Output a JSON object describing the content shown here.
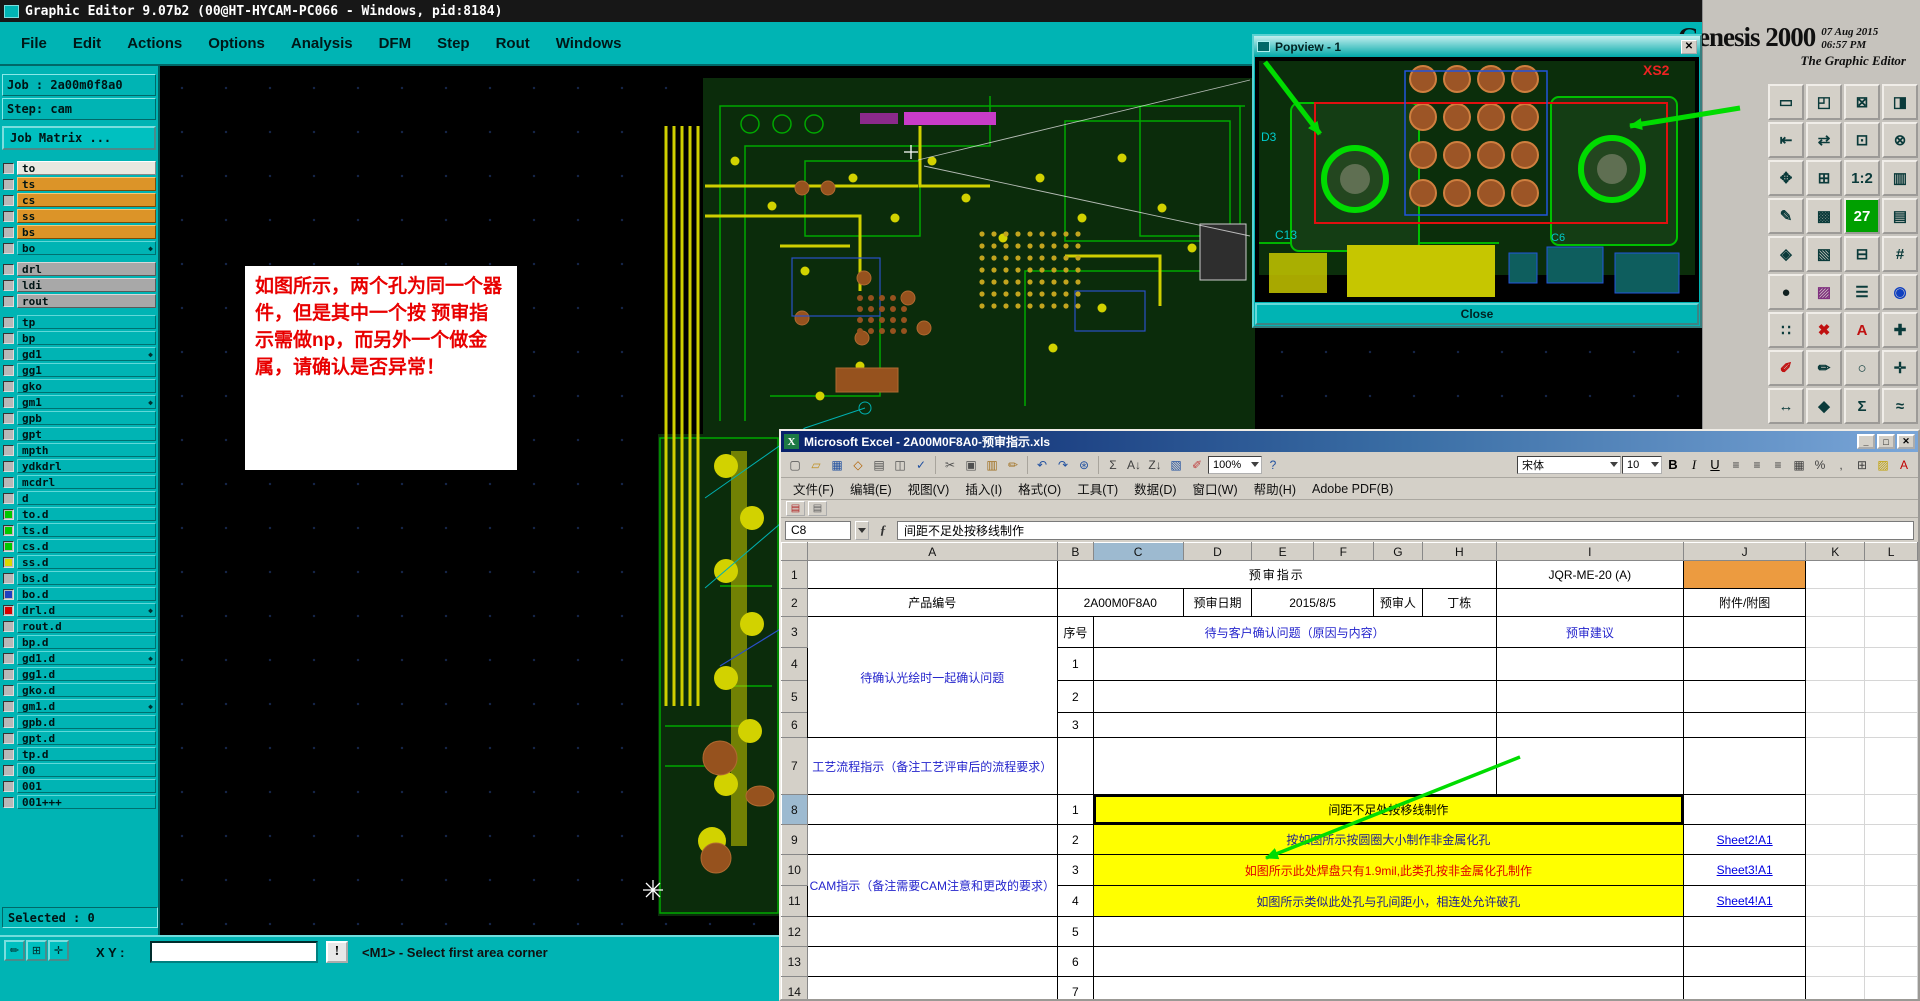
{
  "genesis": {
    "title": "Graphic Editor 9.07b2 (00@HT-HYCAM-PC066 - Windows, pid:8184)",
    "menu": [
      "File",
      "Edit",
      "Actions",
      "Options",
      "Analysis",
      "DFM",
      "Step",
      "Rout",
      "Windows"
    ],
    "job": "Job : 2a00m0f8a0",
    "step": "Step: cam",
    "matrix": "Job Matrix ...",
    "logo": {
      "brand": "Genesis 2000",
      "date": "07 Aug 2015",
      "time": "06:57 PM",
      "subtitle": "The Graphic Editor"
    },
    "layers": [
      {
        "label": "to",
        "color": "white"
      },
      {
        "label": "ts",
        "color": "orange"
      },
      {
        "label": "cs",
        "color": "orange"
      },
      {
        "label": "ss",
        "color": "orange"
      },
      {
        "label": "bs",
        "color": "orange"
      },
      {
        "label": "bo",
        "color": "teal",
        "marker": true
      },
      {
        "gap": true
      },
      {
        "label": "drl",
        "color": "gray"
      },
      {
        "label": "ldi",
        "color": "gray"
      },
      {
        "label": "rout",
        "color": "gray"
      },
      {
        "gap": true
      },
      {
        "label": "tp",
        "color": "teal"
      },
      {
        "label": "bp",
        "color": "teal"
      },
      {
        "label": "gd1",
        "color": "teal",
        "marker": true
      },
      {
        "label": "gg1",
        "color": "teal"
      },
      {
        "label": "gko",
        "color": "teal"
      },
      {
        "label": "gm1",
        "color": "teal",
        "marker": true
      },
      {
        "label": "gpb",
        "color": "teal"
      },
      {
        "label": "gpt",
        "color": "teal"
      },
      {
        "label": "mpth",
        "color": "teal"
      },
      {
        "label": "ydkdrl",
        "color": "teal"
      },
      {
        "label": "mcdrl",
        "color": "teal"
      },
      {
        "label": "d",
        "color": "teal"
      },
      {
        "label": "to.d",
        "color": "teal",
        "dot": "#00c800"
      },
      {
        "label": "ts.d",
        "color": "teal",
        "dot": "#00c800"
      },
      {
        "label": "cs.d",
        "color": "teal",
        "dot": "#00c800"
      },
      {
        "label": "ss.d",
        "color": "teal",
        "dot": "#d8d800"
      },
      {
        "label": "bs.d",
        "color": "teal"
      },
      {
        "label": "bo.d",
        "color": "teal",
        "dot": "#2040c0"
      },
      {
        "label": "drl.d",
        "color": "teal",
        "dot": "#d80000",
        "marker": true
      },
      {
        "label": "rout.d",
        "color": "teal"
      },
      {
        "label": "bp.d",
        "color": "teal"
      },
      {
        "label": "gd1.d",
        "color": "teal",
        "marker": true
      },
      {
        "label": "gg1.d",
        "color": "teal"
      },
      {
        "label": "gko.d",
        "color": "teal"
      },
      {
        "label": "gm1.d",
        "color": "teal",
        "marker": true
      },
      {
        "label": "gpb.d",
        "color": "teal"
      },
      {
        "label": "gpt.d",
        "color": "teal"
      },
      {
        "label": "tp.d",
        "color": "teal"
      },
      {
        "label": "00",
        "color": "teal"
      },
      {
        "label": "001",
        "color": "teal"
      },
      {
        "label": "001+++",
        "color": "teal"
      }
    ],
    "annotation": "如图所示，两个孔为同一个器件，但是其中一个按 预审指示需做np，而另外一个做金属，请确认是否异常！",
    "selected": "Selected : 0",
    "xy_label": "X Y :",
    "xy_value": "",
    "alert": "!",
    "status_message": "<M1> - Select first area corner",
    "status_buttons": [
      {
        "name": "select-mode-icon",
        "glyph": "✏"
      },
      {
        "name": "grid-toggle-icon",
        "glyph": "⊞"
      },
      {
        "name": "snap-toggle-icon",
        "glyph": "✛"
      }
    ],
    "toolbar_icons": [
      {
        "name": "screen-icon",
        "glyph": "▭",
        "color": "#0a3a3a"
      },
      {
        "name": "swap-screen-icon",
        "glyph": "◰",
        "color": "#0a3a3a"
      },
      {
        "name": "lock-icon",
        "glyph": "⊠",
        "color": "#0a3a3a"
      },
      {
        "name": "panel-icon",
        "glyph": "◨",
        "color": "#0a3a3a"
      },
      {
        "name": "pan-left-icon",
        "glyph": "⇤",
        "color": "#0a3a3a"
      },
      {
        "name": "pan-swap-icon",
        "glyph": "⇄",
        "color": "#0a3a3a"
      },
      {
        "name": "center-view-icon",
        "glyph": "⊡",
        "color": "#0a3a3a"
      },
      {
        "name": "close-view-icon",
        "glyph": "⊗",
        "color": "#0a3a3a"
      },
      {
        "name": "fit-view-icon",
        "glyph": "✥",
        "color": "#0a3a3a"
      },
      {
        "name": "grid-icon",
        "glyph": "⊞",
        "color": "#0a3a3a"
      },
      {
        "name": "zoom-1-2-icon",
        "glyph": "1:2",
        "color": "#0a3a3a"
      },
      {
        "name": "layers-view-icon",
        "glyph": "▥",
        "color": "#0a3a3a"
      },
      {
        "name": "edit-profile-icon",
        "glyph": "✎",
        "color": "#0a3a3a"
      },
      {
        "name": "hatch-icon",
        "glyph": "▩",
        "color": "#0a3a3a"
      },
      {
        "name": "badge-27-icon",
        "glyph": "27",
        "color": "#ffffff",
        "bg": "#00a000"
      },
      {
        "name": "rows-icon",
        "glyph": "▤",
        "color": "#0a3a3a"
      },
      {
        "name": "diamond-view-icon",
        "glyph": "◈",
        "color": "#0a3a3a"
      },
      {
        "name": "shade-icon",
        "glyph": "▧",
        "color": "#0a3a3a"
      },
      {
        "name": "minus-box-icon",
        "glyph": "⊟",
        "color": "#0a3a3a"
      },
      {
        "name": "net-icon",
        "glyph": "#",
        "color": "#0a3a3a"
      },
      {
        "name": "dot-icon",
        "glyph": "●",
        "color": "#102020"
      },
      {
        "name": "pattern-icon",
        "glyph": "▨",
        "color": "#803080"
      },
      {
        "name": "list-icon",
        "glyph": "☰",
        "color": "#0a3a3a"
      },
      {
        "name": "target-icon",
        "glyph": "◉",
        "color": "#1040c0"
      },
      {
        "name": "matrix-dots-icon",
        "glyph": "∷",
        "color": "#0a3a3a"
      },
      {
        "name": "delete-icon",
        "glyph": "✖",
        "color": "#c01010"
      },
      {
        "name": "text-a-icon",
        "glyph": "A",
        "color": "#c01010"
      },
      {
        "name": "add-icon",
        "glyph": "✚",
        "color": "#0a3a3a"
      },
      {
        "name": "pen-red-icon",
        "glyph": "✐",
        "color": "#c01010"
      },
      {
        "name": "pencil-icon",
        "glyph": "✏",
        "color": "#0a3a3a"
      },
      {
        "name": "circle-icon",
        "glyph": "○",
        "color": "#0a3a3a"
      },
      {
        "name": "cross-icon",
        "glyph": "✛",
        "color": "#0a3a3a"
      },
      {
        "name": "move-icon",
        "glyph": "↔",
        "color": "#0a3a3a"
      },
      {
        "name": "diamond-icon",
        "glyph": "◆",
        "color": "#0a3a3a"
      },
      {
        "name": "sum-icon",
        "glyph": "Σ",
        "color": "#0a3a3a"
      },
      {
        "name": "wave-icon",
        "glyph": "≈",
        "color": "#0a3a3a"
      }
    ]
  },
  "popview": {
    "title": "Popview - 1",
    "close_label": "Close",
    "close_icon": "✕",
    "labels": {
      "xs2": "XS2",
      "d3": "D3",
      "c13": "C13",
      "c6": "C6"
    }
  },
  "excel": {
    "title": "Microsoft Excel - 2A00M0F8A0-预审指示.xls",
    "app_icon": "X",
    "window_controls": [
      {
        "name": "minimize-button",
        "glyph": "_"
      },
      {
        "name": "maximize-button",
        "glyph": "□"
      },
      {
        "name": "close-button",
        "glyph": "✕"
      }
    ],
    "menus": [
      "文件(F)",
      "编辑(E)",
      "视图(V)",
      "插入(I)",
      "格式(O)",
      "工具(T)",
      "数据(D)",
      "窗口(W)",
      "帮助(H)",
      "Adobe PDF(B)"
    ],
    "zoom": "100%",
    "help_icon": {
      "glyph": "?",
      "color": "#2050a0"
    },
    "font_name": "宋体",
    "font_size": "10",
    "name_box": "C8",
    "fx": "ƒ",
    "formula": "间距不足处按移线制作",
    "toolbar": [
      {
        "name": "new-icon",
        "glyph": "▢",
        "color": "#505050"
      },
      {
        "name": "open-icon",
        "glyph": "▱",
        "color": "#c09020"
      },
      {
        "name": "save-icon",
        "glyph": "▦",
        "color": "#2050a0"
      },
      {
        "name": "permission-icon",
        "glyph": "◇",
        "color": "#b06000"
      },
      {
        "name": "print-icon",
        "glyph": "▤",
        "color": "#505050"
      },
      {
        "name": "print-preview-icon",
        "glyph": "◫",
        "color": "#505050"
      },
      {
        "name": "spelling-icon",
        "glyph": "✓",
        "color": "#2050a0"
      },
      {
        "name": "cut-icon",
        "glyph": "✂",
        "color": "#505050"
      },
      {
        "name": "copy-icon",
        "glyph": "▣",
        "color": "#505050"
      },
      {
        "name": "paste-icon",
        "glyph": "▥",
        "color": "#a07020"
      },
      {
        "name": "format-painter-icon",
        "glyph": "✏",
        "color": "#a07020"
      },
      {
        "name": "undo-icon",
        "glyph": "↶",
        "color": "#2050a0"
      },
      {
        "name": "redo-icon",
        "glyph": "↷",
        "color": "#2050a0"
      },
      {
        "name": "hyperlink-icon",
        "glyph": "⊛",
        "color": "#2050a0"
      },
      {
        "name": "autosum-icon",
        "glyph": "Σ",
        "color": "#404040"
      },
      {
        "name": "sort-ascending-icon",
        "glyph": "A↓",
        "color": "#404040"
      },
      {
        "name": "sort-descending-icon",
        "glyph": "Z↓",
        "color": "#404040"
      },
      {
        "name": "chart-wizard-icon",
        "glyph": "▧",
        "color": "#2050a0"
      },
      {
        "name": "drawing-icon",
        "glyph": "✐",
        "color": "#c04040"
      }
    ],
    "format_toolbar": [
      {
        "name": "bold-button",
        "glyph": "B",
        "color": "#000000",
        "bold": true
      },
      {
        "name": "italic-button",
        "glyph": "I",
        "color": "#000000",
        "italic": true
      },
      {
        "name": "underline-button",
        "glyph": "U",
        "color": "#000000",
        "underline": true
      },
      {
        "name": "align-left-icon",
        "glyph": "≡",
        "color": "#404040"
      },
      {
        "name": "align-center-icon",
        "glyph": "≡",
        "color": "#404040"
      },
      {
        "name": "align-right-icon",
        "glyph": "≡",
        "color": "#404040"
      },
      {
        "name": "merge-center-icon",
        "glyph": "▦",
        "color": "#404040"
      },
      {
        "name": "percent-icon",
        "glyph": "%",
        "color": "#404040"
      },
      {
        "name": "comma-icon",
        "glyph": ",",
        "color": "#404040"
      },
      {
        "name": "borders-icon",
        "glyph": "⊞",
        "color": "#404040"
      },
      {
        "name": "fill-color-icon",
        "glyph": "▨",
        "color": "#c0a000"
      },
      {
        "name": "font-color-icon",
        "glyph": "A",
        "color": "#c00000"
      }
    ],
    "pdf_toolbar": [
      {
        "name": "adobe-pdf-icon-1",
        "glyph": "▤",
        "color": "#b02020"
      },
      {
        "name": "adobe-pdf-icon-2",
        "glyph": "▤",
        "color": "#606060"
      }
    ],
    "columns": [
      "A",
      "B",
      "C",
      "D",
      "E",
      "F",
      "G",
      "H",
      "I",
      "J",
      "K",
      "L"
    ],
    "active_column": "C",
    "active_row": 8,
    "rows": 14,
    "cells": [
      {
        "r": 1,
        "c": "A",
        "text": ""
      },
      {
        "r": 1,
        "c": "B",
        "span": 7,
        "text": "预审指示",
        "cls": "title"
      },
      {
        "r": 1,
        "c": "I",
        "text": "JQR-ME-20 (A)",
        "cls": "bold"
      },
      {
        "r": 1,
        "c": "J",
        "text": "",
        "cls": "orange"
      },
      {
        "r": 2,
        "c": "A",
        "text": "产品编号",
        "cls": "bold"
      },
      {
        "r": 2,
        "c": "B",
        "span": 2,
        "text": "2A00M0F8A0"
      },
      {
        "r": 2,
        "c": "D",
        "text": "预审日期",
        "cls": "bold"
      },
      {
        "r": 2,
        "c": "E",
        "span": 2,
        "text": "2015/8/5"
      },
      {
        "r": 2,
        "c": "G",
        "text": "预审人",
        "cls": "bold"
      },
      {
        "r": 2,
        "c": "H",
        "text": "丁栋",
        "cls": "bold"
      },
      {
        "r": 2,
        "c": "I",
        "text": ""
      },
      {
        "r": 2,
        "c": "J",
        "text": "附件/附图",
        "cls": "bold"
      },
      {
        "r": 3,
        "c": "A",
        "rowspan": 4,
        "text": "待确认光绘时一起确认问题",
        "cls": "blue bold wrap"
      },
      {
        "r": 3,
        "c": "B",
        "text": "序号",
        "cls": "bold"
      },
      {
        "r": 3,
        "c": "C",
        "span": 6,
        "text": "待与客户确认问题（原因与内容）",
        "cls": "blue bold"
      },
      {
        "r": 3,
        "c": "I",
        "text": "预审建议",
        "cls": "blue bold"
      },
      {
        "r": 3,
        "c": "J",
        "text": ""
      },
      {
        "r": 4,
        "c": "B",
        "text": "1"
      },
      {
        "r": 4,
        "c": "C",
        "span": 6,
        "text": ""
      },
      {
        "r": 4,
        "c": "I",
        "text": ""
      },
      {
        "r": 4,
        "c": "J",
        "text": ""
      },
      {
        "r": 5,
        "c": "B",
        "text": "2"
      },
      {
        "r": 5,
        "c": "C",
        "span": 6,
        "text": ""
      },
      {
        "r": 5,
        "c": "I",
        "text": ""
      },
      {
        "r": 5,
        "c": "J",
        "text": ""
      },
      {
        "r": 6,
        "c": "B",
        "text": "3"
      },
      {
        "r": 6,
        "c": "C",
        "span": 6,
        "text": ""
      },
      {
        "r": 6,
        "c": "I",
        "text": ""
      },
      {
        "r": 6,
        "c": "J",
        "text": ""
      },
      {
        "r": 7,
        "c": "A",
        "text": "工艺流程指示（备注工艺评审后的流程要求）",
        "cls": "blue wrap left"
      },
      {
        "r": 7,
        "c": "B",
        "text": ""
      },
      {
        "r": 7,
        "c": "C",
        "span": 6,
        "text": ""
      },
      {
        "r": 7,
        "c": "I",
        "text": ""
      },
      {
        "r": 7,
        "c": "J",
        "text": ""
      },
      {
        "r": 8,
        "c": "A",
        "text": ""
      },
      {
        "r": 8,
        "c": "B",
        "text": "1"
      },
      {
        "r": 8,
        "c": "C",
        "span": 7,
        "text": "间距不足处按移线制作",
        "cls": "yellow bold left active"
      },
      {
        "r": 8,
        "c": "J",
        "text": ""
      },
      {
        "r": 9,
        "c": "A",
        "text": ""
      },
      {
        "r": 9,
        "c": "B",
        "text": "2"
      },
      {
        "r": 9,
        "c": "C",
        "span": 7,
        "text": "按如图所示按圆圈大小制作非金属化孔",
        "cls": "yellow bold left navy"
      },
      {
        "r": 9,
        "c": "J",
        "text": "Sheet2!A1",
        "cls": "link"
      },
      {
        "r": 10,
        "c": "A",
        "rowspan": 2,
        "text": "CAM指示（备注需要CAM注意和更改的要求）",
        "cls": "blue wrap left"
      },
      {
        "r": 10,
        "c": "B",
        "text": "3"
      },
      {
        "r": 10,
        "c": "C",
        "span": 7,
        "text": "如图所示此处焊盘只有1.9mil,此类孔按非金属化孔制作",
        "cls": "yellow bold left red"
      },
      {
        "r": 10,
        "c": "J",
        "text": "Sheet3!A1",
        "cls": "link"
      },
      {
        "r": 11,
        "c": "B",
        "text": "4"
      },
      {
        "r": 11,
        "c": "C",
        "span": 7,
        "text": "如图所示类似此处孔与孔间距小，相连处允许破孔",
        "cls": "yellow bold left navy"
      },
      {
        "r": 11,
        "c": "J",
        "text": "Sheet4!A1",
        "cls": "link"
      },
      {
        "r": 12,
        "c": "A",
        "text": ""
      },
      {
        "r": 12,
        "c": "B",
        "text": "5"
      },
      {
        "r": 12,
        "c": "C",
        "span": 7,
        "text": ""
      },
      {
        "r": 12,
        "c": "J",
        "text": ""
      },
      {
        "r": 13,
        "c": "A",
        "text": ""
      },
      {
        "r": 13,
        "c": "B",
        "text": "6"
      },
      {
        "r": 13,
        "c": "C",
        "span": 7,
        "text": ""
      },
      {
        "r": 13,
        "c": "J",
        "text": ""
      },
      {
        "r": 14,
        "c": "A",
        "text": ""
      },
      {
        "r": 14,
        "c": "B",
        "text": "7"
      },
      {
        "r": 14,
        "c": "C",
        "span": 7,
        "text": ""
      },
      {
        "r": 14,
        "c": "J",
        "text": ""
      }
    ]
  },
  "accent": {
    "arrow_color": "#00dc00",
    "highlight_yellow": "#ffff00"
  }
}
